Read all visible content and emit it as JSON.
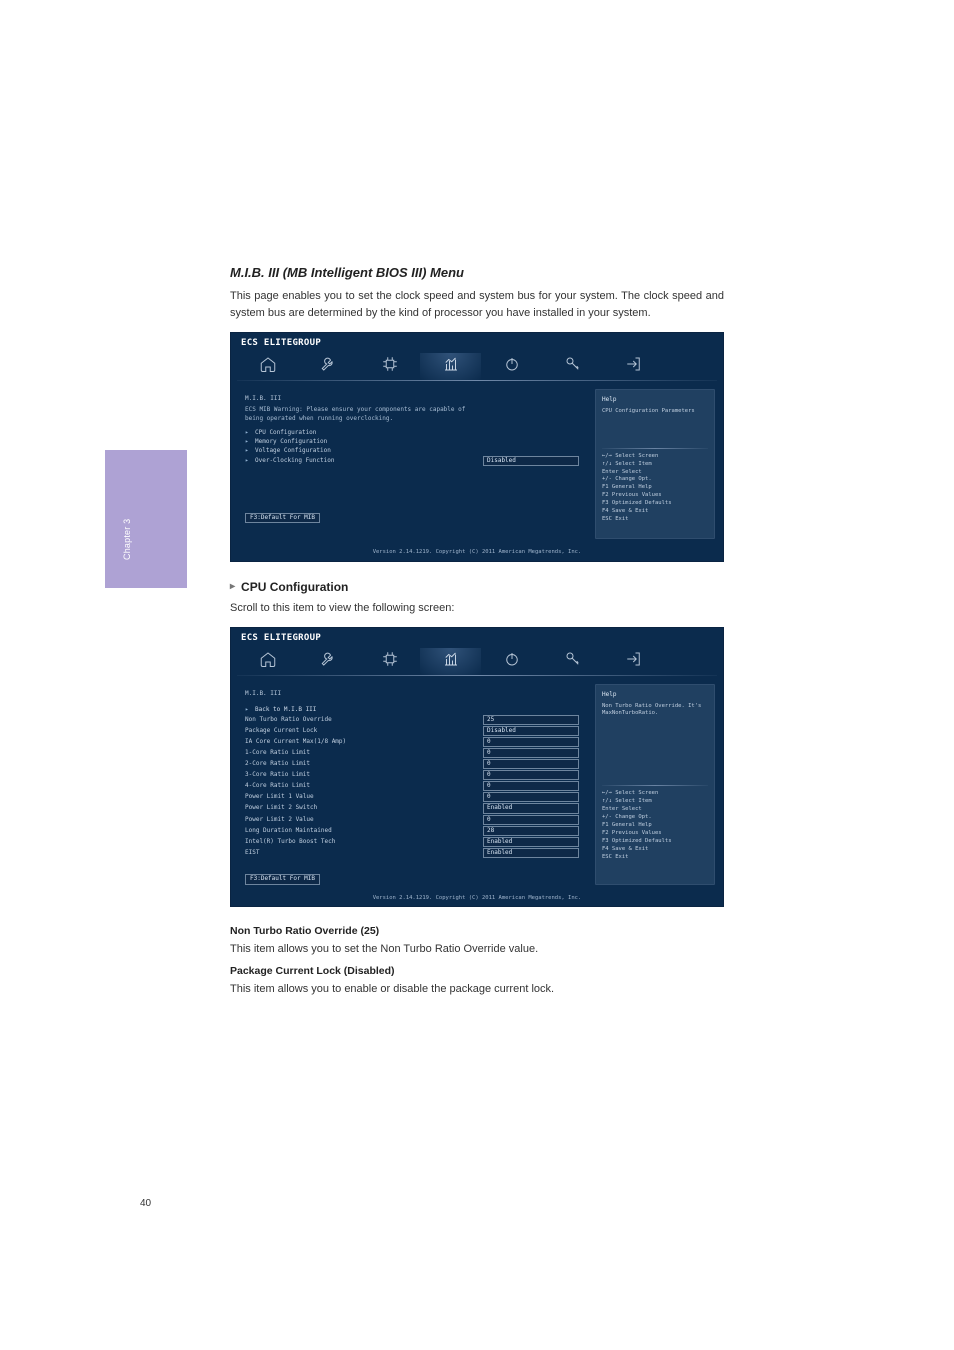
{
  "chapter_side": "Chapter 3",
  "page_number": "40",
  "section": {
    "title": "M.I.B. III (MB Intelligent BIOS III) Menu",
    "intro": "This page enables you to set the clock speed and system bus for your system. The clock speed and system bus are determined by the kind of processor you have installed in your system."
  },
  "bios_brand": "ECS ELITEGROUP",
  "nav_tabs": [
    "Main",
    "Advanced",
    "Chipset",
    "M.I.B. III",
    "Boot",
    "Security",
    "Exit"
  ],
  "bios1": {
    "page_title": "M.I.B. III",
    "warning1": "ECS MIB Warning: Please ensure your components are capable of",
    "warning2": "being operated when running overclocking.",
    "rows": [
      {
        "label": "CPU Configuration",
        "arrow": true
      },
      {
        "label": "Memory Configuration",
        "arrow": true
      },
      {
        "label": "Voltage Configuration",
        "arrow": true
      },
      {
        "label": "Over-Clocking Function",
        "value": "Disabled",
        "boxed": true
      }
    ],
    "f_button": "F3:Default For MIB",
    "help_title": "Help",
    "help_text": "CPU Configuration Parameters",
    "keys": [
      "←/→ Select Screen",
      "↑/↓ Select Item",
      "Enter Select",
      "+/- Change Opt.",
      "F1 General Help",
      "F2 Previous Values",
      "F3 Optimized Defaults",
      "F4 Save & Exit",
      "ESC Exit"
    ],
    "version": "Version 2.14.1219. Copyright (C) 2011 American Megatrends, Inc."
  },
  "cpu_section": {
    "heading": "CPU Configuration",
    "intro": "Scroll to this item to view the following screen:"
  },
  "bios2": {
    "page_title": "M.I.B. III",
    "back": "Back to M.I.B III",
    "rows": [
      {
        "label": "Non Turbo Ratio Override",
        "value": "25",
        "boxed": true
      },
      {
        "label": "Package Current Lock",
        "value": "Disabled",
        "boxed": true
      },
      {
        "label": "IA Core Current Max(1/8 Amp)",
        "value": "0",
        "boxed": true
      },
      {
        "label": "1-Core Ratio Limit",
        "value": "0",
        "boxed": true
      },
      {
        "label": "2-Core Ratio Limit",
        "value": "0",
        "boxed": true
      },
      {
        "label": "3-Core Ratio Limit",
        "value": "0",
        "boxed": true
      },
      {
        "label": "4-Core Ratio Limit",
        "value": "0",
        "boxed": true
      },
      {
        "label": "Power Limit 1 Value",
        "value": "0",
        "boxed": true
      },
      {
        "label": "Power Limit 2 Switch",
        "value": "Enabled",
        "boxed": true
      },
      {
        "label": "Power Limit 2 Value",
        "value": "0",
        "boxed": true
      },
      {
        "label": "Long Duration Maintained",
        "value": "28",
        "boxed": true
      },
      {
        "label": "Intel(R) Turbo Boost Tech",
        "value": "Enabled",
        "boxed": true
      },
      {
        "label": "EIST",
        "value": "Enabled",
        "boxed": true
      }
    ],
    "f_button": "F3:Default For MIB",
    "help_title": "Help",
    "help_text": "Non Turbo Ratio Override. It's MaxNonTurboRatio.",
    "keys": [
      "←/→ Select Screen",
      "↑/↓ Select Item",
      "Enter Select",
      "+/- Change Opt.",
      "F1 General Help",
      "F2 Previous Values",
      "F3 Optimized Defaults",
      "F4 Save & Exit",
      "ESC Exit"
    ],
    "version": "Version 2.14.1219. Copyright (C) 2011 American Megatrends, Inc."
  },
  "items": [
    {
      "head": "Non Turbo Ratio Override (25)",
      "desc": "This item allows you to set the Non Turbo Ratio Override value."
    },
    {
      "head": "Package Current Lock (Disabled)",
      "desc": "This item allows you to enable or disable the package current lock."
    }
  ]
}
